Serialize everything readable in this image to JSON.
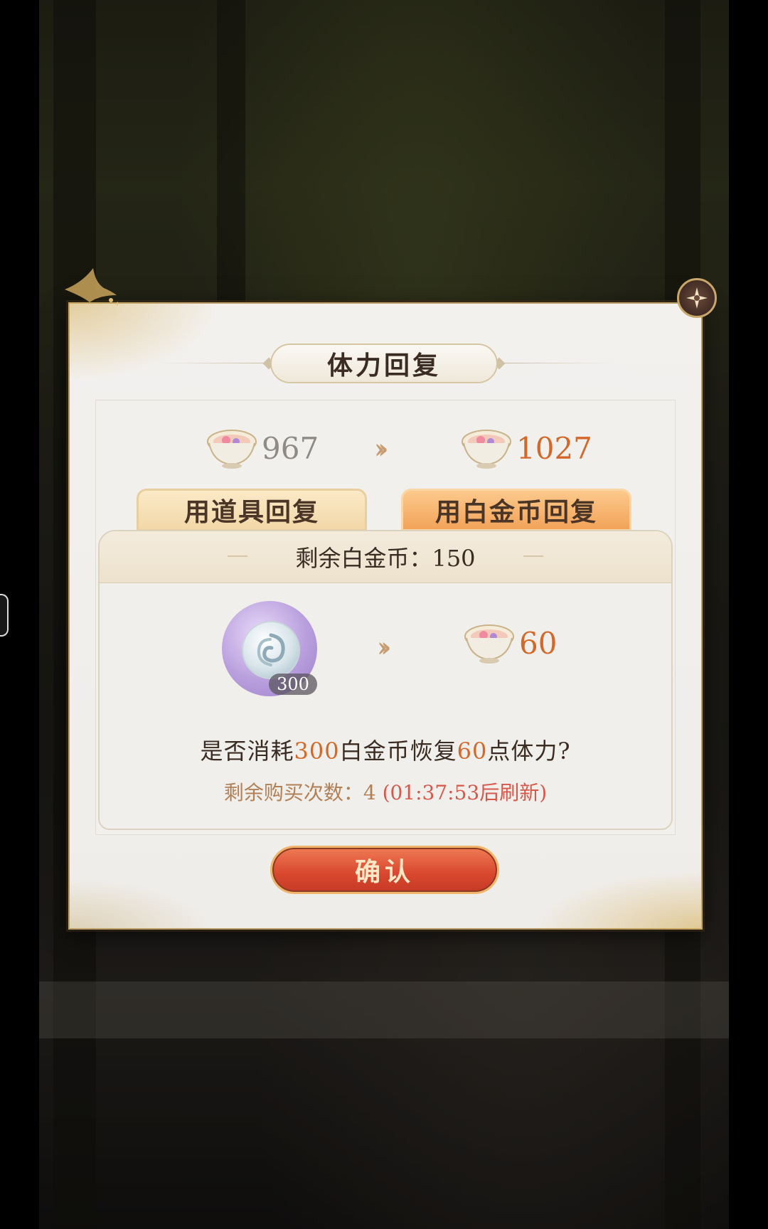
{
  "dialog": {
    "title": "体力回复",
    "stamina_current": "967",
    "stamina_after": "1027",
    "tabs": [
      {
        "label": "用道具回复",
        "active": false
      },
      {
        "label": "用白金币回复",
        "active": true
      }
    ],
    "remaining_coins_label": "剩余白金币：150",
    "cost_badge": "300",
    "gain_amount": "60",
    "question": {
      "prefix": "是否消耗",
      "cost": "300",
      "middle": "白金币恢复",
      "gain": "60",
      "suffix": "点体力?"
    },
    "purchase": {
      "label": "剩余购买次数：4",
      "refresh": "(01:37:53后刷新)"
    },
    "confirm_label": "确认"
  },
  "colors": {
    "accent_orange": "#d2692a",
    "refresh_red": "#d5584a",
    "confirm_red": "#d8472e",
    "gold_border": "#b89a63"
  },
  "icons": [
    "stamina-cup-icon",
    "double-chevron-right-icon",
    "platinum-coin-icon",
    "close-icon",
    "bird-ornament-icon"
  ]
}
